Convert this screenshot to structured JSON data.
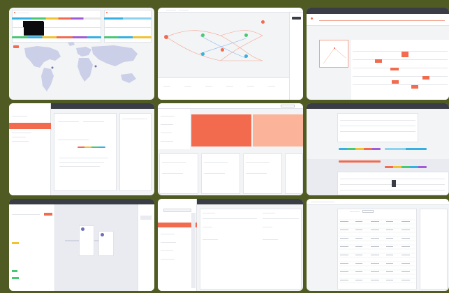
{
  "grid": {
    "background": "#4f5b23",
    "accent": "#f26b4f",
    "accent_light": "#fbb49a",
    "dark_header": "#3a3d46"
  },
  "tiles": [
    {
      "id": "world-map-dashboard",
      "icons": [
        "world-map-icon",
        "tooltip-panel"
      ]
    },
    {
      "id": "flow-diagram",
      "icons": [
        "node-icon"
      ]
    },
    {
      "id": "timeline-gantt",
      "icons": [
        "gantt-bar"
      ]
    },
    {
      "id": "settings-form",
      "icons": [
        "sidebar-item"
      ]
    },
    {
      "id": "treemap-dashboard",
      "icons": [
        "treemap-block"
      ]
    },
    {
      "id": "data-table-dashboard",
      "icons": [
        "color-strip"
      ]
    },
    {
      "id": "workflow-builder",
      "icons": [
        "workflow-node-icon"
      ]
    },
    {
      "id": "sidebar-form",
      "icons": [
        "sidebar-highlight"
      ]
    },
    {
      "id": "spreadsheet-table",
      "icons": [
        "table-grid"
      ]
    }
  ]
}
